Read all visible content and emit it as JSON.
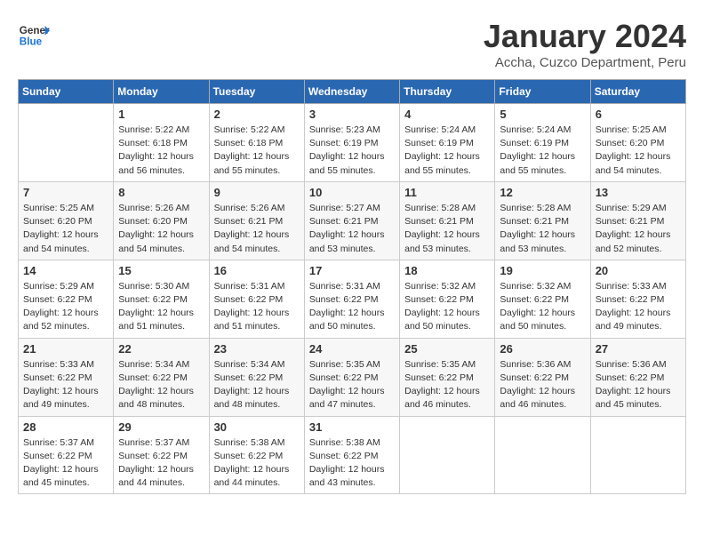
{
  "header": {
    "logo_general": "General",
    "logo_blue": "Blue",
    "month_title": "January 2024",
    "subtitle": "Accha, Cuzco Department, Peru"
  },
  "days_of_week": [
    "Sunday",
    "Monday",
    "Tuesday",
    "Wednesday",
    "Thursday",
    "Friday",
    "Saturday"
  ],
  "weeks": [
    [
      {
        "num": "",
        "info": ""
      },
      {
        "num": "1",
        "info": "Sunrise: 5:22 AM\nSunset: 6:18 PM\nDaylight: 12 hours\nand 56 minutes."
      },
      {
        "num": "2",
        "info": "Sunrise: 5:22 AM\nSunset: 6:18 PM\nDaylight: 12 hours\nand 55 minutes."
      },
      {
        "num": "3",
        "info": "Sunrise: 5:23 AM\nSunset: 6:19 PM\nDaylight: 12 hours\nand 55 minutes."
      },
      {
        "num": "4",
        "info": "Sunrise: 5:24 AM\nSunset: 6:19 PM\nDaylight: 12 hours\nand 55 minutes."
      },
      {
        "num": "5",
        "info": "Sunrise: 5:24 AM\nSunset: 6:19 PM\nDaylight: 12 hours\nand 55 minutes."
      },
      {
        "num": "6",
        "info": "Sunrise: 5:25 AM\nSunset: 6:20 PM\nDaylight: 12 hours\nand 54 minutes."
      }
    ],
    [
      {
        "num": "7",
        "info": "Sunrise: 5:25 AM\nSunset: 6:20 PM\nDaylight: 12 hours\nand 54 minutes."
      },
      {
        "num": "8",
        "info": "Sunrise: 5:26 AM\nSunset: 6:20 PM\nDaylight: 12 hours\nand 54 minutes."
      },
      {
        "num": "9",
        "info": "Sunrise: 5:26 AM\nSunset: 6:21 PM\nDaylight: 12 hours\nand 54 minutes."
      },
      {
        "num": "10",
        "info": "Sunrise: 5:27 AM\nSunset: 6:21 PM\nDaylight: 12 hours\nand 53 minutes."
      },
      {
        "num": "11",
        "info": "Sunrise: 5:28 AM\nSunset: 6:21 PM\nDaylight: 12 hours\nand 53 minutes."
      },
      {
        "num": "12",
        "info": "Sunrise: 5:28 AM\nSunset: 6:21 PM\nDaylight: 12 hours\nand 53 minutes."
      },
      {
        "num": "13",
        "info": "Sunrise: 5:29 AM\nSunset: 6:21 PM\nDaylight: 12 hours\nand 52 minutes."
      }
    ],
    [
      {
        "num": "14",
        "info": "Sunrise: 5:29 AM\nSunset: 6:22 PM\nDaylight: 12 hours\nand 52 minutes."
      },
      {
        "num": "15",
        "info": "Sunrise: 5:30 AM\nSunset: 6:22 PM\nDaylight: 12 hours\nand 51 minutes."
      },
      {
        "num": "16",
        "info": "Sunrise: 5:31 AM\nSunset: 6:22 PM\nDaylight: 12 hours\nand 51 minutes."
      },
      {
        "num": "17",
        "info": "Sunrise: 5:31 AM\nSunset: 6:22 PM\nDaylight: 12 hours\nand 50 minutes."
      },
      {
        "num": "18",
        "info": "Sunrise: 5:32 AM\nSunset: 6:22 PM\nDaylight: 12 hours\nand 50 minutes."
      },
      {
        "num": "19",
        "info": "Sunrise: 5:32 AM\nSunset: 6:22 PM\nDaylight: 12 hours\nand 50 minutes."
      },
      {
        "num": "20",
        "info": "Sunrise: 5:33 AM\nSunset: 6:22 PM\nDaylight: 12 hours\nand 49 minutes."
      }
    ],
    [
      {
        "num": "21",
        "info": "Sunrise: 5:33 AM\nSunset: 6:22 PM\nDaylight: 12 hours\nand 49 minutes."
      },
      {
        "num": "22",
        "info": "Sunrise: 5:34 AM\nSunset: 6:22 PM\nDaylight: 12 hours\nand 48 minutes."
      },
      {
        "num": "23",
        "info": "Sunrise: 5:34 AM\nSunset: 6:22 PM\nDaylight: 12 hours\nand 48 minutes."
      },
      {
        "num": "24",
        "info": "Sunrise: 5:35 AM\nSunset: 6:22 PM\nDaylight: 12 hours\nand 47 minutes."
      },
      {
        "num": "25",
        "info": "Sunrise: 5:35 AM\nSunset: 6:22 PM\nDaylight: 12 hours\nand 46 minutes."
      },
      {
        "num": "26",
        "info": "Sunrise: 5:36 AM\nSunset: 6:22 PM\nDaylight: 12 hours\nand 46 minutes."
      },
      {
        "num": "27",
        "info": "Sunrise: 5:36 AM\nSunset: 6:22 PM\nDaylight: 12 hours\nand 45 minutes."
      }
    ],
    [
      {
        "num": "28",
        "info": "Sunrise: 5:37 AM\nSunset: 6:22 PM\nDaylight: 12 hours\nand 45 minutes."
      },
      {
        "num": "29",
        "info": "Sunrise: 5:37 AM\nSunset: 6:22 PM\nDaylight: 12 hours\nand 44 minutes."
      },
      {
        "num": "30",
        "info": "Sunrise: 5:38 AM\nSunset: 6:22 PM\nDaylight: 12 hours\nand 44 minutes."
      },
      {
        "num": "31",
        "info": "Sunrise: 5:38 AM\nSunset: 6:22 PM\nDaylight: 12 hours\nand 43 minutes."
      },
      {
        "num": "",
        "info": ""
      },
      {
        "num": "",
        "info": ""
      },
      {
        "num": "",
        "info": ""
      }
    ]
  ]
}
